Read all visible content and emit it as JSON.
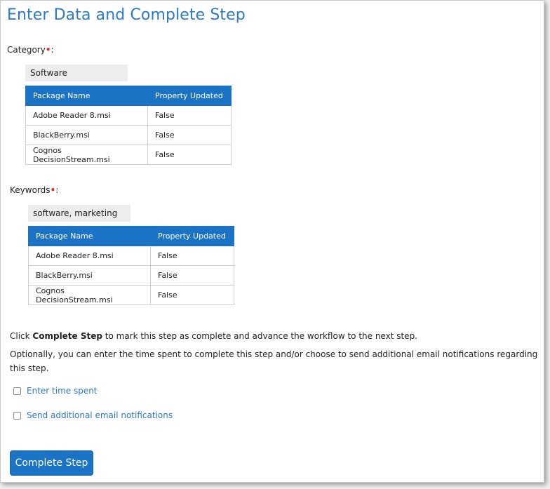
{
  "title": "Enter Data and Complete Step",
  "category": {
    "label": "Category",
    "required_marker": "•",
    "colon": ":",
    "value": "Software",
    "table": {
      "headers": [
        "Package Name",
        "Property Updated"
      ],
      "rows": [
        [
          "Adobe Reader 8.msi",
          "False"
        ],
        [
          "BlackBerry.msi",
          "False"
        ],
        [
          "Cognos DecisionStream.msi",
          "False"
        ]
      ]
    }
  },
  "keywords": {
    "label": "Keywords",
    "required_marker": "•",
    "colon": ":",
    "value": "software, marketing",
    "table": {
      "headers": [
        "Package Name",
        "Property Updated"
      ],
      "rows": [
        [
          "Adobe Reader 8.msi",
          "False"
        ],
        [
          "BlackBerry.msi",
          "False"
        ],
        [
          "Cognos DecisionStream.msi",
          "False"
        ]
      ]
    }
  },
  "instructions": {
    "line1_prefix": "Click ",
    "line1_bold": "Complete Step",
    "line1_suffix": " to mark this step as complete and advance the workflow to the next step.",
    "line2": "Optionally, you can enter the time spent to complete this step and/or choose to send additional email notifications regarding this step."
  },
  "options": {
    "time_spent_label": "Enter time spent",
    "email_notifications_label": "Send additional email notifications"
  },
  "complete_button_label": "Complete Step",
  "colors": {
    "title": "#2d7ac0",
    "header_bg": "#1a73c4",
    "required": "#d9342b"
  }
}
